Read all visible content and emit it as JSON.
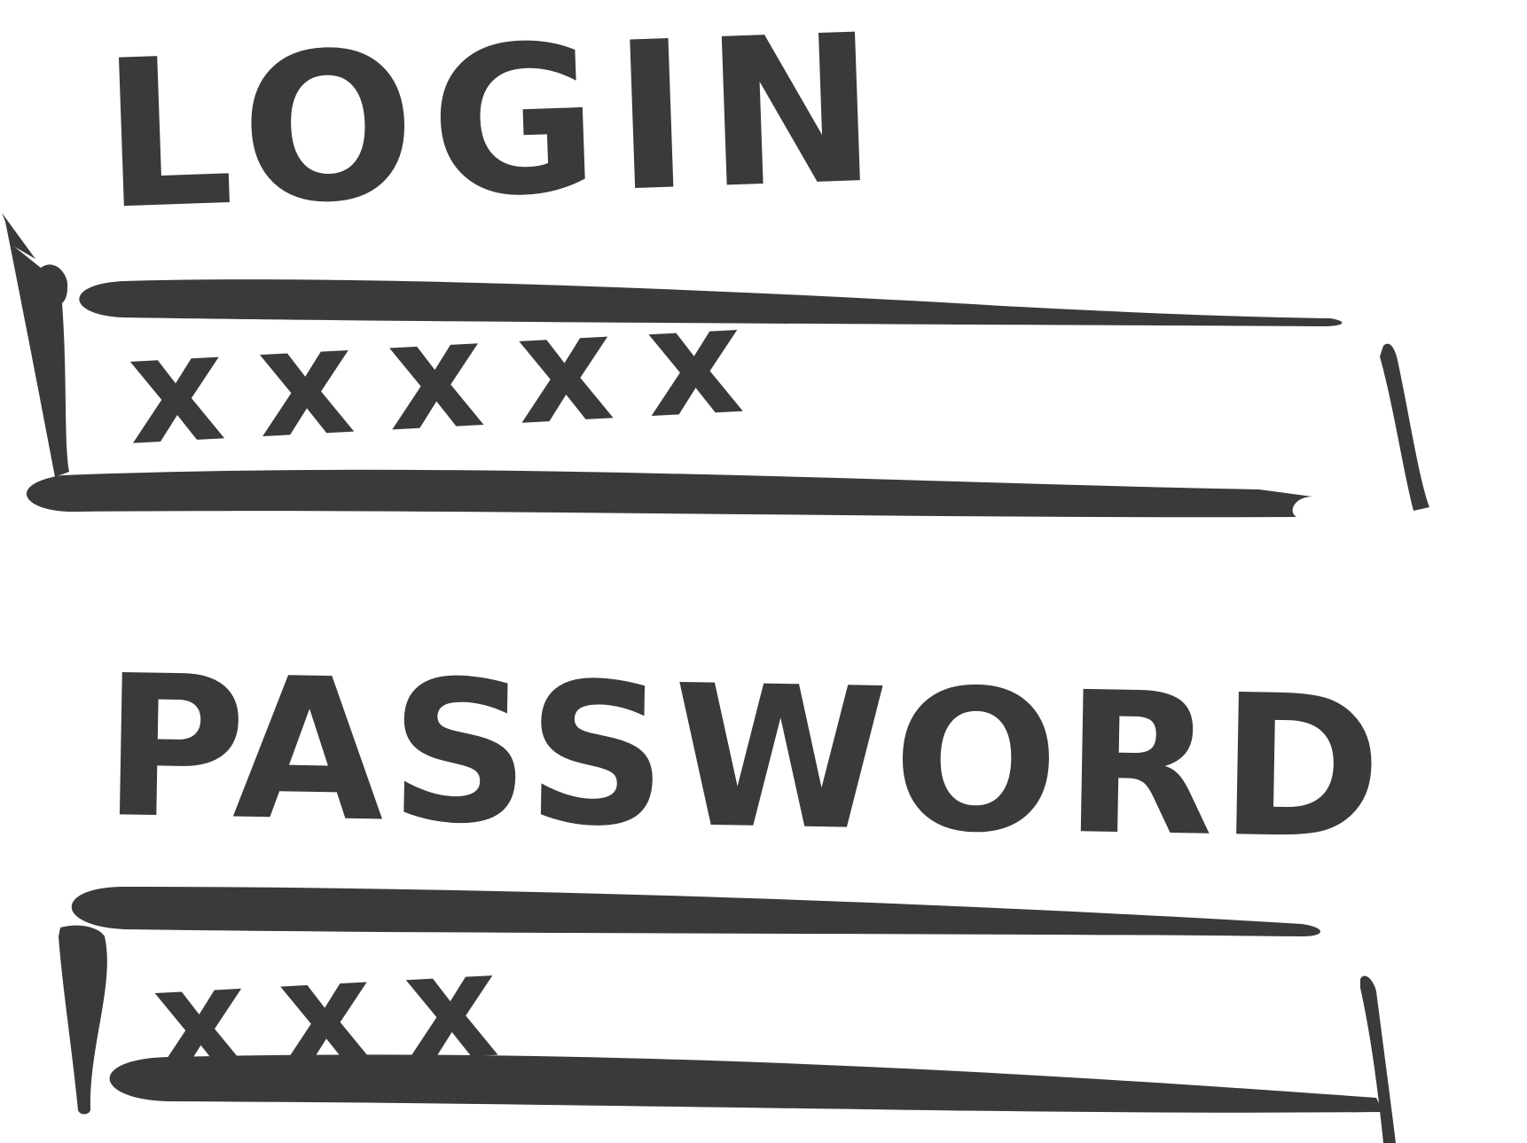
{
  "form": {
    "login": {
      "label": "LOGIN",
      "value": "xxxxx"
    },
    "password": {
      "label": "PASSWORD",
      "value": "xxx"
    }
  },
  "colors": {
    "ink": "#3a3a39",
    "background": "#ffffff"
  },
  "style": "hand-drawn sketch"
}
